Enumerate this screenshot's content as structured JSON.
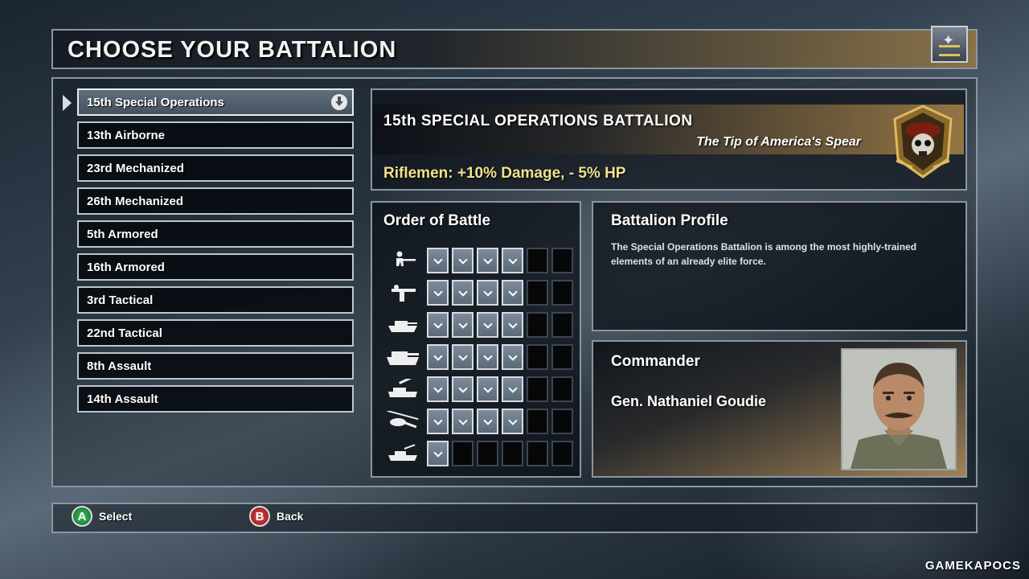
{
  "title_bar": {
    "title": "CHOOSE YOUR BATTALION",
    "emblem_icon": "eagle-rank-icon"
  },
  "battalions": [
    {
      "label": "15th Special Operations",
      "selected": true
    },
    {
      "label": "13th Airborne"
    },
    {
      "label": "23rd Mechanized"
    },
    {
      "label": "26th Mechanized"
    },
    {
      "label": "5th Armored"
    },
    {
      "label": "16th Armored"
    },
    {
      "label": "3rd Tactical"
    },
    {
      "label": "22nd Tactical"
    },
    {
      "label": "8th Assault"
    },
    {
      "label": "14th Assault"
    }
  ],
  "detail": {
    "name": "15th SPECIAL OPERATIONS BATTALION",
    "motto": "The Tip of America's Spear",
    "bonus": "Riflemen: +10% Damage, - 5% HP",
    "emblem_icon": "skull-beret-emblem"
  },
  "order_of_battle": {
    "title": "Order of Battle",
    "rows": [
      {
        "unit_icon": "rifleman-icon",
        "filled": 4,
        "total": 6
      },
      {
        "unit_icon": "heavy-gunner-icon",
        "filled": 4,
        "total": 6
      },
      {
        "unit_icon": "light-tank-icon",
        "filled": 4,
        "total": 6
      },
      {
        "unit_icon": "heavy-tank-icon",
        "filled": 4,
        "total": 6
      },
      {
        "unit_icon": "artillery-icon",
        "filled": 4,
        "total": 6
      },
      {
        "unit_icon": "helicopter-icon",
        "filled": 4,
        "total": 6
      },
      {
        "unit_icon": "aa-vehicle-icon",
        "filled": 1,
        "total": 6
      }
    ]
  },
  "profile": {
    "title": "Battalion Profile",
    "text": "The Special Operations Battalion is among the most highly-trained elements of an already elite force."
  },
  "commander": {
    "title": "Commander",
    "name": "Gen. Nathaniel Goudie",
    "portrait_icon": "commander-portrait"
  },
  "buttons": {
    "select": {
      "key": "A",
      "label": "Select"
    },
    "back": {
      "key": "B",
      "label": "Back"
    }
  },
  "watermark": "GAMEKAPOCS",
  "colors": {
    "bonus_text": "#f0e28c",
    "accent_gold": "#a07d46",
    "a_button": "#1f9a3f",
    "b_button": "#c02828"
  }
}
